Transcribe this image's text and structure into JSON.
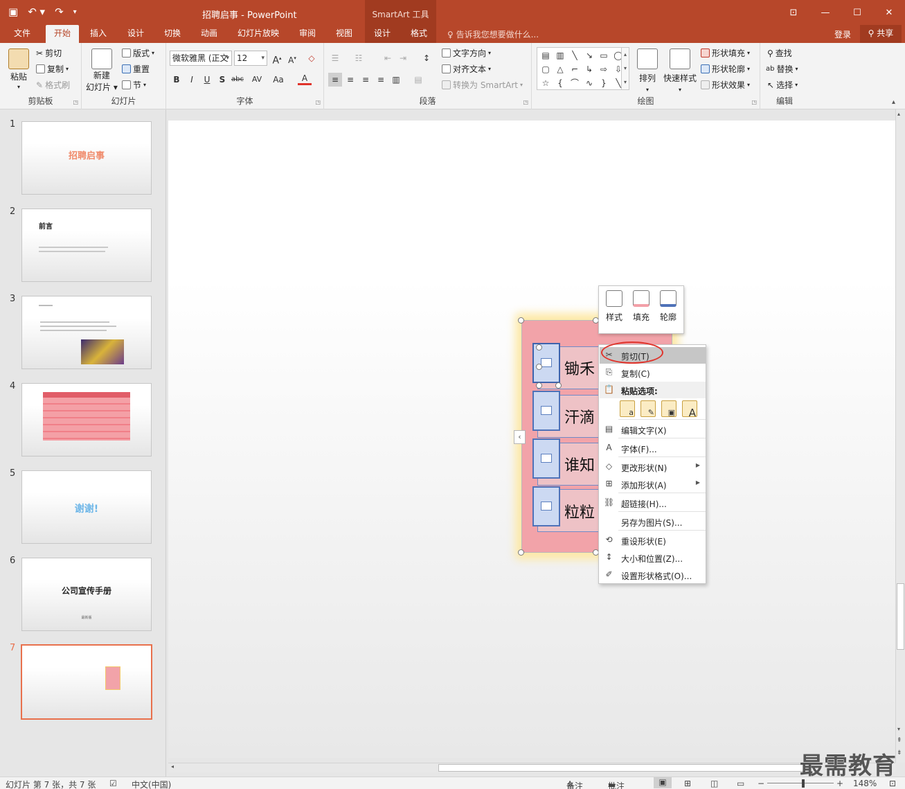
{
  "window": {
    "title": "招聘启事 - PowerPoint",
    "context_tab_group": "SmartArt 工具"
  },
  "tabs": [
    {
      "label": "文件"
    },
    {
      "label": "开始"
    },
    {
      "label": "插入"
    },
    {
      "label": "设计"
    },
    {
      "label": "切换"
    },
    {
      "label": "动画"
    },
    {
      "label": "幻灯片放映"
    },
    {
      "label": "审阅"
    },
    {
      "label": "视图"
    },
    {
      "label": "设计"
    },
    {
      "label": "格式"
    }
  ],
  "tell_me": "告诉我您想要做什么...",
  "account": {
    "login": "登录",
    "share": "共享"
  },
  "ribbon": {
    "clipboard": {
      "label": "剪贴板",
      "paste": "粘贴",
      "cut": "剪切",
      "copy": "复制",
      "format_painter": "格式刷"
    },
    "slides": {
      "label": "幻灯片",
      "new_slide_1": "新建",
      "new_slide_2": "幻灯片",
      "layout": "版式",
      "reset": "重置",
      "section": "节"
    },
    "font": {
      "label": "字体",
      "font_name": "微软雅黑 (正文",
      "font_size": "12",
      "bold": "B",
      "italic": "I",
      "underline": "U",
      "shadow": "S",
      "strike": "abc",
      "spacing": "AV",
      "case": "Aa"
    },
    "paragraph": {
      "label": "段落",
      "text_direction": "文字方向",
      "align_text": "对齐文本",
      "convert_smartart": "转换为 SmartArt"
    },
    "drawing": {
      "label": "绘图",
      "arrange": "排列",
      "quick_styles": "快速样式",
      "shape_fill": "形状填充",
      "shape_outline": "形状轮廓",
      "shape_effects": "形状效果"
    },
    "editing": {
      "label": "编辑",
      "find": "查找",
      "replace": "替换",
      "select": "选择"
    }
  },
  "thumbnails": [
    {
      "num": "1",
      "title": "招聘启事"
    },
    {
      "num": "2",
      "title": "前言"
    },
    {
      "num": "3",
      "title": ""
    },
    {
      "num": "4",
      "title": ""
    },
    {
      "num": "5",
      "title": "谢谢!"
    },
    {
      "num": "6",
      "title": "公司宣传手册",
      "subtitle": "最新版"
    },
    {
      "num": "7",
      "title": ""
    }
  ],
  "smartart": {
    "rows": [
      {
        "text": "锄禾"
      },
      {
        "text": "汗滴"
      },
      {
        "text": "谁知"
      },
      {
        "text": "粒粒"
      }
    ]
  },
  "mini_toolbar": {
    "style": "样式",
    "fill": "填充",
    "outline": "轮廓"
  },
  "context_menu": {
    "cut": "剪切(T)",
    "copy": "复制(C)",
    "paste_options": "粘贴选项:",
    "edit_text": "编辑文字(X)",
    "font": "字体(F)...",
    "change_shape": "更改形状(N)",
    "add_shape": "添加形状(A)",
    "hyperlink": "超链接(H)...",
    "save_as_picture": "另存为图片(S)...",
    "reset_shape": "重设形状(E)",
    "size_position": "大小和位置(Z)...",
    "format_shape": "设置形状格式(O)..."
  },
  "statusbar": {
    "slide_info": "幻灯片 第 7 张，共 7 张",
    "language": "中文(中国)",
    "notes": "备注",
    "comments": "批注",
    "zoom": "148%"
  },
  "watermark": "最需教育",
  "colors": {
    "accent": "#b7472a",
    "selection": "#e8704c",
    "highlight_circle": "#e0332b"
  }
}
